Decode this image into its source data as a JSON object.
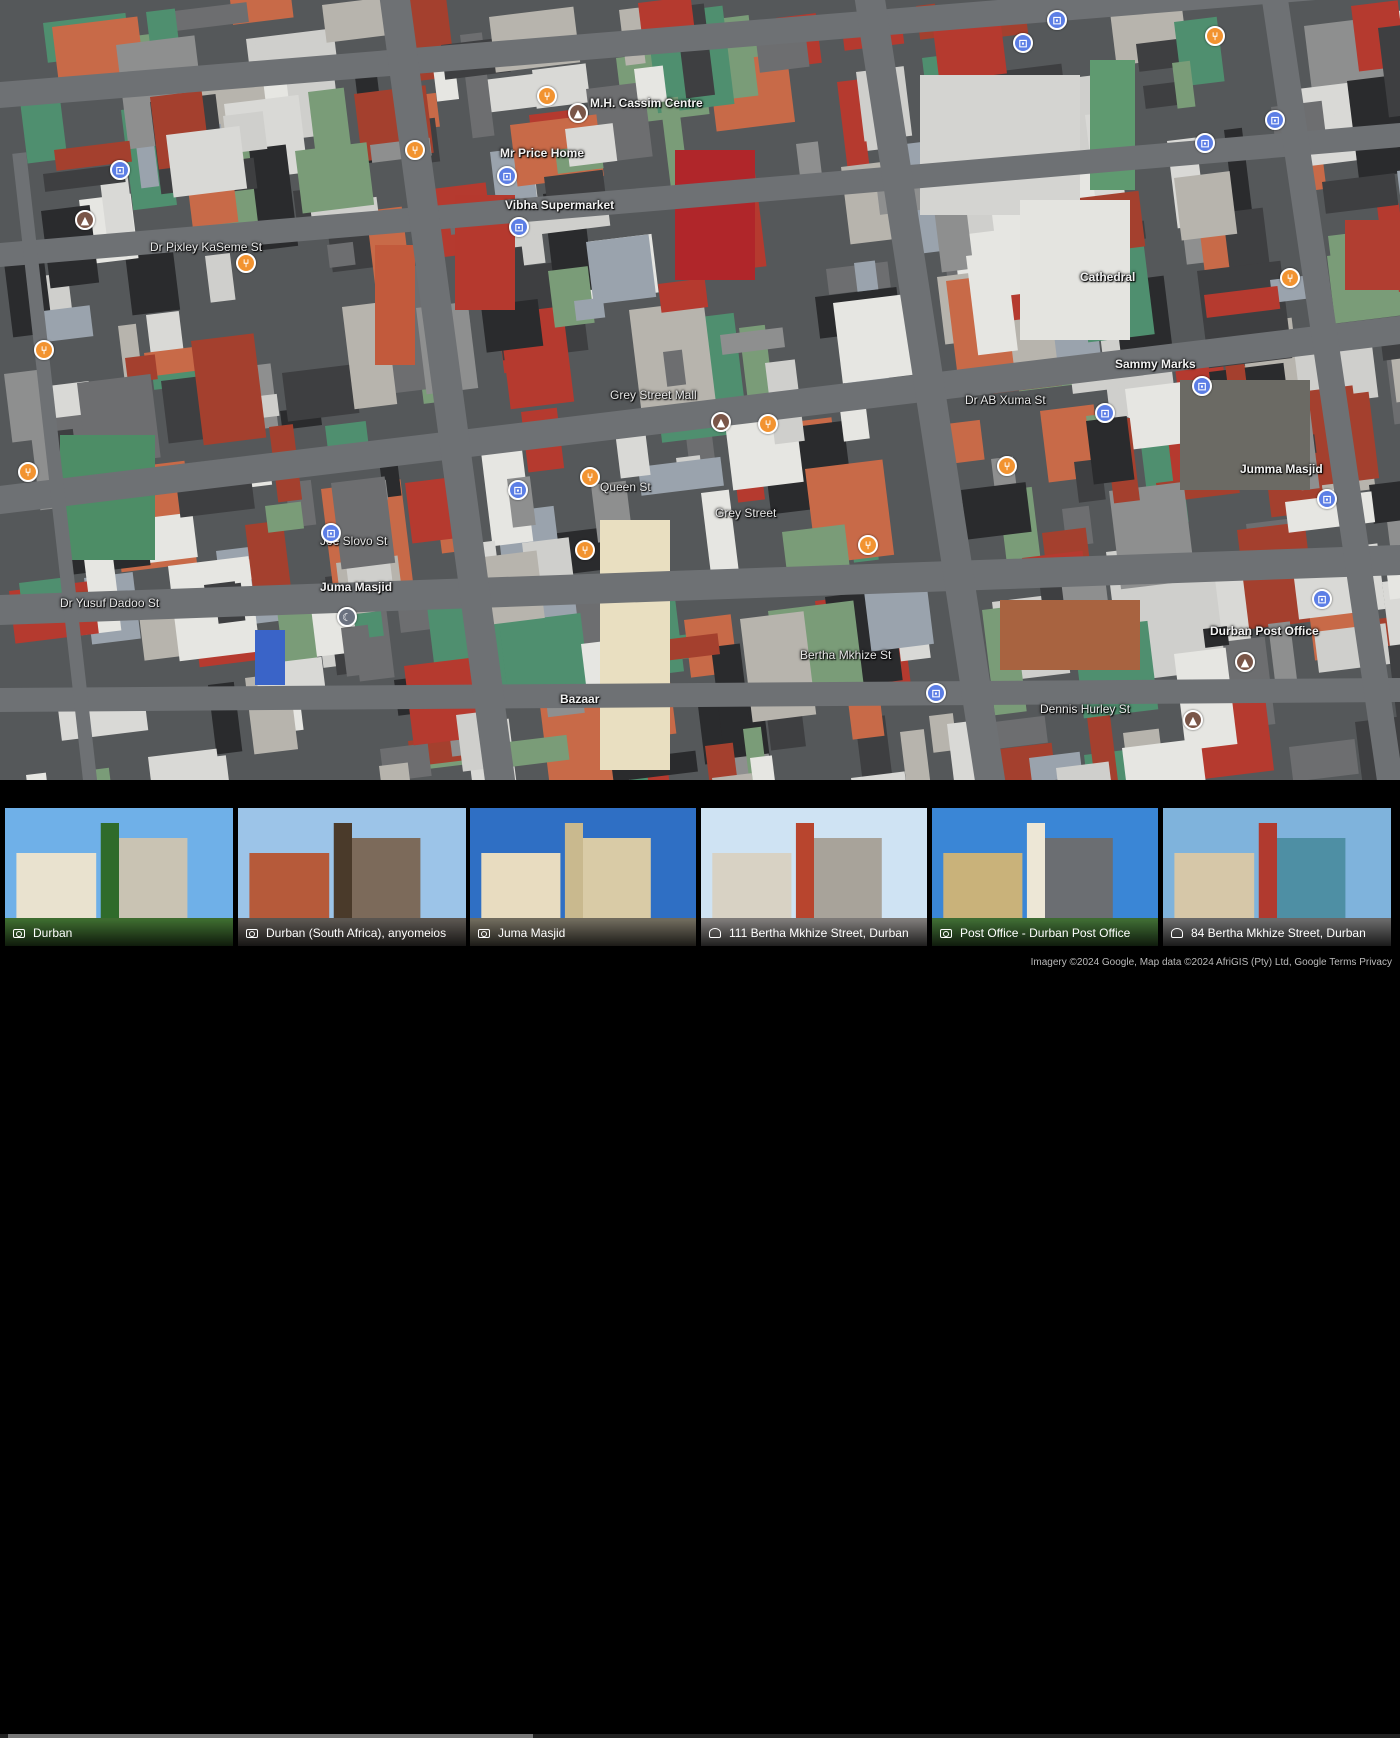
{
  "map": {
    "labels": [
      {
        "text": "M.H. Cassim Centre"
      },
      {
        "text": "Mr Price Home"
      },
      {
        "text": "Vibha Supermarket"
      },
      {
        "text": "Grey Street Mall"
      },
      {
        "text": "Juma Masjid"
      },
      {
        "text": "Dr Yusuf Dadoo St"
      },
      {
        "text": "Dr Pixley KaSeme St"
      },
      {
        "text": "Joe Slovo St"
      },
      {
        "text": "Dr AB Xuma St"
      },
      {
        "text": "Sammy Marks"
      },
      {
        "text": "Dennis Hurley St"
      },
      {
        "text": "Bertha Mkhize St"
      },
      {
        "text": "Durban Post Office"
      },
      {
        "text": "Queen St"
      },
      {
        "text": "Bazaar"
      },
      {
        "text": "Grey Street"
      },
      {
        "text": "Jumma Masjid"
      },
      {
        "text": "Cathedral"
      }
    ],
    "pins": [
      {
        "kind": "food",
        "icon": "fork-knife-icon"
      },
      {
        "kind": "food",
        "icon": "fork-knife-icon"
      },
      {
        "kind": "food",
        "icon": "fork-knife-icon"
      },
      {
        "kind": "food",
        "icon": "fork-knife-icon"
      },
      {
        "kind": "food",
        "icon": "fork-knife-icon"
      },
      {
        "kind": "food",
        "icon": "fork-knife-icon"
      },
      {
        "kind": "food",
        "icon": "fork-knife-icon"
      },
      {
        "kind": "food",
        "icon": "fork-knife-icon"
      },
      {
        "kind": "food",
        "icon": "fork-knife-icon"
      },
      {
        "kind": "food",
        "icon": "fork-knife-icon"
      },
      {
        "kind": "food",
        "icon": "fork-knife-icon"
      },
      {
        "kind": "food",
        "icon": "fork-knife-icon"
      },
      {
        "kind": "shop",
        "icon": "shopping-bag-icon"
      },
      {
        "kind": "shop",
        "icon": "shopping-bag-icon"
      },
      {
        "kind": "shop",
        "icon": "shopping-bag-icon"
      },
      {
        "kind": "shop",
        "icon": "shopping-bag-icon"
      },
      {
        "kind": "shop",
        "icon": "shopping-bag-icon"
      },
      {
        "kind": "shop",
        "icon": "shopping-bag-icon"
      },
      {
        "kind": "shop",
        "icon": "shopping-bag-icon"
      },
      {
        "kind": "shop",
        "icon": "shopping-bag-icon"
      },
      {
        "kind": "shop",
        "icon": "shopping-bag-icon"
      },
      {
        "kind": "shop",
        "icon": "shopping-bag-icon"
      },
      {
        "kind": "shop",
        "icon": "shopping-bag-icon"
      },
      {
        "kind": "shop",
        "icon": "shopping-bag-icon"
      },
      {
        "kind": "shop",
        "icon": "shopping-bag-icon"
      },
      {
        "kind": "shop",
        "icon": "shopping-bag-icon"
      },
      {
        "kind": "place",
        "icon": "landmark-icon"
      },
      {
        "kind": "place",
        "icon": "landmark-icon"
      },
      {
        "kind": "place",
        "icon": "landmark-icon"
      },
      {
        "kind": "place",
        "icon": "landmark-icon"
      },
      {
        "kind": "place",
        "icon": "landmark-icon"
      },
      {
        "kind": "worship",
        "icon": "mosque-icon"
      }
    ]
  },
  "photos": [
    {
      "caption": "Durban",
      "icon": "camera-icon"
    },
    {
      "caption": "Durban (South Africa), anyomeios",
      "icon": "camera-icon"
    },
    {
      "caption": "Juma Masjid",
      "icon": "camera-icon"
    },
    {
      "caption": "111 Bertha Mkhize Street, Durban",
      "icon": "street-view-icon"
    },
    {
      "caption": "Post Office - Durban Post Office",
      "icon": "camera-icon"
    },
    {
      "caption": "84 Bertha Mkhize Street, Durban",
      "icon": "street-view-icon"
    }
  ],
  "attribution": "Imagery ©2024 Google, Map data ©2024 AfriGIS (Pty) Ltd, Google    Terms    Privacy"
}
